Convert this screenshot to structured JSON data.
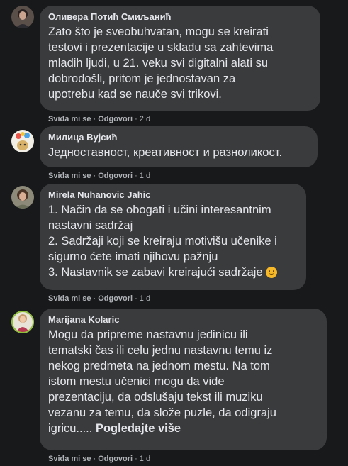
{
  "comments": [
    {
      "author": "Оливера Потић Смиљанић",
      "lines": [
        "Zato što je sveobuhvatan, mogu se kreirati",
        "testovi i prezentacije u skladu sa zahtevima",
        "mladih ljudi, u 21. veku svi digitalni alati su",
        "dobrodošli, pritom je jednostavan za",
        "upotrebu kad se nauče svi trikovi."
      ],
      "like": "Sviđa mi se",
      "reply": "Odgovori",
      "time": "2 d"
    },
    {
      "author": "Милица Вујсић",
      "lines": [
        "Једноставност, креативност и разноликост."
      ],
      "like": "Sviđa mi se",
      "reply": "Odgovori",
      "time": "1 d"
    },
    {
      "author": "Mirela Nuhanovic Jahic",
      "lines": [
        "1. Način da se obogati i učini interesantnim",
        "nastavni sadržaj",
        "2. Sadržaji koji se kreiraju motivišu učenike i",
        "sigurno ćete imati njihovu pažnju",
        "3. Nastavnik se zabavi kreirajući sadržaje"
      ],
      "emoji": "smiling-face-emoji",
      "like": "Sviđa mi se",
      "reply": "Odgovori",
      "time": "1 d"
    },
    {
      "author": "Marijana Kolaric",
      "lines": [
        "Mogu da pripreme nastavnu jedinicu ili",
        "tematski čas ili celu jednu nastavnu temu iz",
        "nekog predmeta na jednom mestu. Na tom",
        "istom mestu učenici mogu da vide",
        "prezentaciju, da odslušaju tekst ili muziku",
        "vezanu za temu, da slože puzle, da odigraju",
        "igricu....."
      ],
      "see_more": "Pogledajte više",
      "like": "Sviđa mi se",
      "reply": "Odgovori",
      "time": "1 d"
    }
  ],
  "separator": "·",
  "colors": {
    "background": "#18191a",
    "bubble": "#3a3b3c",
    "text": "#e4e6eb",
    "secondary": "#b0b3b8"
  }
}
